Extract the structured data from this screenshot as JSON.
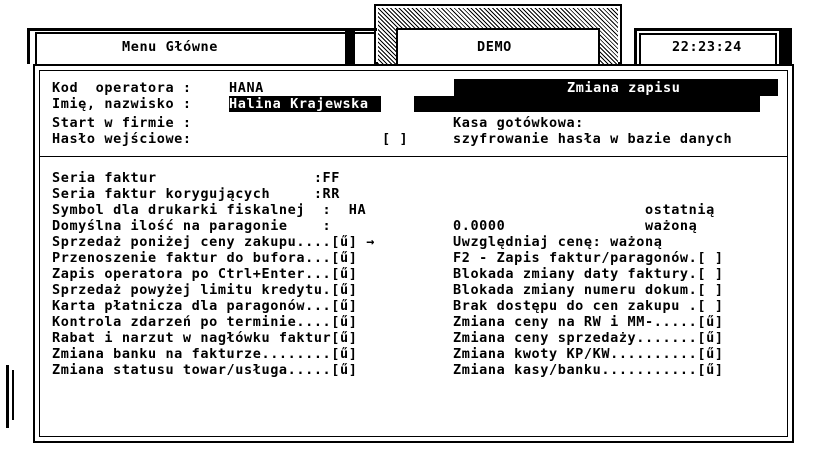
{
  "header": {
    "menu_title": "Menu Główne",
    "demo_label": "DEMO",
    "clock": "22:23:24"
  },
  "operator": {
    "kod_label": "Kod  operatora : ",
    "kod_value": "HANA",
    "imie_label": "Imię, nazwisko : ",
    "imie_value": "Halina Krajewska",
    "start_label": "Start w firmie :",
    "haslo_label": "Hasło wejściowe:",
    "haslo_check": "[ ]",
    "zmiana_title": "Zmiana zapisu",
    "kasa_label": "Kasa gotówkowa:",
    "szyfr_label": "szyfrowanie hasła w bazie danych"
  },
  "settings_left": [
    "Seria faktur                  :FF",
    "Seria faktur korygujących     :RR",
    "Symbol dla drukarki fiskalnej  :  HA",
    "Domyślna ilość na paragonie    :",
    "Sprzedaż poniżej ceny zakupu....[ű] →",
    "Przenoszenie faktur do bufora...[ű]",
    "Zapis operatora po Ctrl+Enter...[ű]",
    "Sprzedaż powyżej limitu kredytu.[ű]",
    "Karta płatnicza dla paragonów...[ű]",
    "Kontrola zdarzeń po terminie....[ű]",
    "Rabat i narzut w nagłówku faktur[ű]",
    "Zmiana banku na fakturze........[ű]",
    "Zmiana statusu towar/usługa.....[ű]"
  ],
  "settings_right": [
    "",
    "",
    "                      ostatnią",
    "0.0000                ważoną",
    "Uwzględniaj cenę: ważoną",
    "F2 - Zapis faktur/paragonów.[ ]",
    "Blokada zmiany daty faktury.[ ]",
    "Blokada zmiany numeru dokum.[ ]",
    "Brak dostępu do cen zakupu .[ ]",
    "Zmiana ceny na RW i MM-.....[ű]",
    "Zmiana ceny sprzedaży.......[ű]",
    "Zmiana kwoty KP/KW..........[ű]",
    "Zmiana kasy/banku...........[ű]"
  ]
}
